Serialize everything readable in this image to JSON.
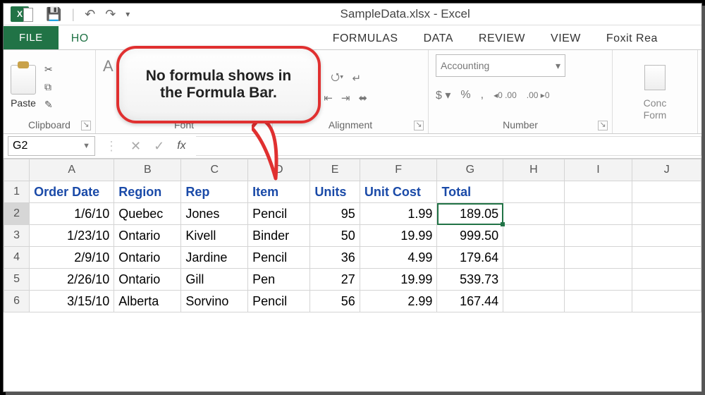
{
  "app": {
    "title": "SampleData.xlsx - Excel",
    "logo_letter": "X"
  },
  "qat": {
    "save": "💾",
    "undo": "↶",
    "redo": "↷",
    "dd": "▾"
  },
  "tabs": {
    "file": "FILE",
    "home": "HO",
    "formulas": "FORMULAS",
    "data": "DATA",
    "review": "REVIEW",
    "view": "VIEW",
    "foxit": "Foxit Rea"
  },
  "ribbon": {
    "clipboard": {
      "label": "Clipboard",
      "paste": "Paste",
      "cut": "✂",
      "copy": "⧉",
      "fmt": "✎"
    },
    "font": {
      "label": "Font",
      "family_hint": "A"
    },
    "alignment": {
      "label": "Alignment",
      "top": "≡",
      "mid": "≡",
      "bot": "≡",
      "wrap": "↵",
      "left": "≡",
      "ctr": "≡",
      "right": "≡",
      "indent_less": "⇤",
      "indent_more": "⇥",
      "merge": "⬌"
    },
    "number": {
      "label": "Number",
      "format": "Accounting",
      "currency": "$ ▾",
      "percent": "%",
      "comma": ",",
      "inc_dec": "◂0 .00",
      "dec_dec": ".00 ▸0"
    },
    "styles": {
      "cond": "Conc",
      "cond2": "Form"
    }
  },
  "formula_bar": {
    "name_box": "G2",
    "cancel": "✕",
    "enter": "✓",
    "fx": "fx",
    "value": ""
  },
  "columns": [
    "A",
    "B",
    "C",
    "D",
    "E",
    "F",
    "G",
    "H",
    "I",
    "J"
  ],
  "selected_col_index": 6,
  "row_headers": [
    "1",
    "2",
    "3",
    "4",
    "5",
    "6"
  ],
  "selected_row_index": 1,
  "headers": [
    "Order Date",
    "Region",
    "Rep",
    "Item",
    "Units",
    "Unit Cost",
    "Total"
  ],
  "rows": [
    {
      "date": "1/6/10",
      "region": "Quebec",
      "rep": "Jones",
      "item": "Pencil",
      "units": "95",
      "cost": "1.99",
      "total": "189.05"
    },
    {
      "date": "1/23/10",
      "region": "Ontario",
      "rep": "Kivell",
      "item": "Binder",
      "units": "50",
      "cost": "19.99",
      "total": "999.50"
    },
    {
      "date": "2/9/10",
      "region": "Ontario",
      "rep": "Jardine",
      "item": "Pencil",
      "units": "36",
      "cost": "4.99",
      "total": "179.64"
    },
    {
      "date": "2/26/10",
      "region": "Ontario",
      "rep": "Gill",
      "item": "Pen",
      "units": "27",
      "cost": "19.99",
      "total": "539.73"
    },
    {
      "date": "3/15/10",
      "region": "Alberta",
      "rep": "Sorvino",
      "item": "Pencil",
      "units": "56",
      "cost": "2.99",
      "total": "167.44"
    }
  ],
  "callout": {
    "text": "No formula shows in the Formula Bar."
  }
}
